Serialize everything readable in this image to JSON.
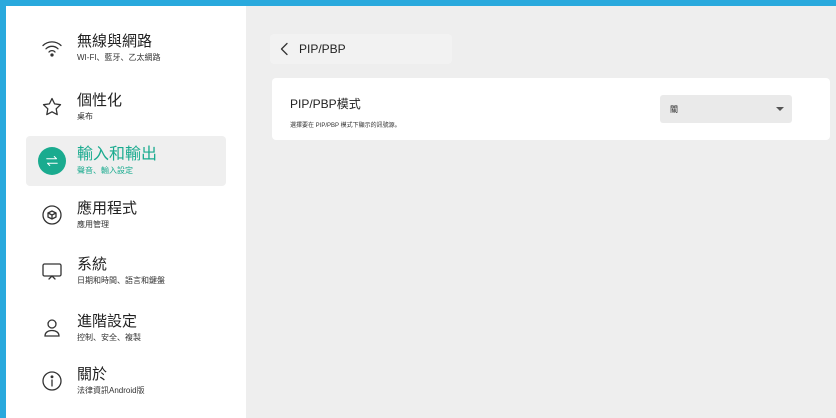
{
  "sidebar": {
    "items": [
      {
        "label": "無線與網路",
        "sub": "WI-FI、藍牙、乙太網路",
        "icon": "wifi-icon"
      },
      {
        "label": "個性化",
        "sub": "桌布",
        "icon": "star-icon"
      },
      {
        "label": "輸入和輸出",
        "sub": "聲音、輸入設定",
        "icon": "swap-arrows-icon",
        "active": true
      },
      {
        "label": "應用程式",
        "sub": "應用管理",
        "icon": "cube-icon"
      },
      {
        "label": "系統",
        "sub": "日期和時間、語言和鍵盤",
        "icon": "monitor-icon"
      },
      {
        "label": "進階設定",
        "sub": "控制、安全、複製",
        "icon": "user-icon"
      },
      {
        "label": "關於",
        "sub": "法律資訊Android版",
        "icon": "info-icon"
      }
    ]
  },
  "header": {
    "back_title": "PIP/PBP"
  },
  "setting": {
    "title": "PIP/PBP模式",
    "description": "選擇要在 PIP/PBP 模式下顯示的訊號源。",
    "selected": "關"
  },
  "colors": {
    "accent": "#1aab8f",
    "border": "#29a9dd"
  }
}
